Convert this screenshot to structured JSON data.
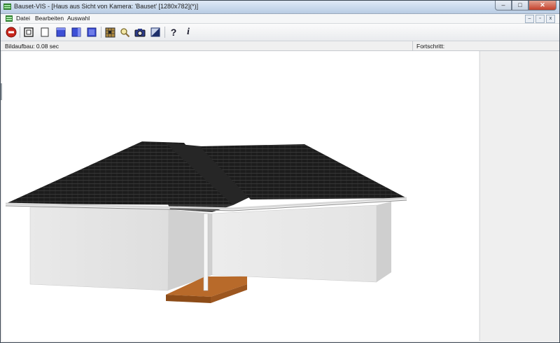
{
  "window": {
    "title": "Bauset-VIS - [Haus aus Sicht von Kamera: 'Bauset' [1280x782](*)]",
    "controls": {
      "minimize": "–",
      "maximize": "□",
      "close": "✕"
    }
  },
  "menubar": {
    "items": [
      {
        "label": "Datei"
      },
      {
        "label": "Bearbeiten"
      },
      {
        "label": "Auswahl"
      }
    ],
    "mdi_controls": {
      "minimize": "–",
      "restore": "▫",
      "close": "x"
    }
  },
  "toolbar": {
    "buttons": [
      {
        "icon": "stop-icon"
      },
      {
        "icon": "frame-view-icon"
      },
      {
        "icon": "blank-page-icon"
      },
      {
        "icon": "cube-view-front-icon"
      },
      {
        "icon": "cube-view-side-icon"
      },
      {
        "icon": "cube-view-top-icon"
      },
      {
        "icon": "texture-icon"
      },
      {
        "icon": "zoom-icon"
      },
      {
        "icon": "camera-icon"
      },
      {
        "icon": "render-icon"
      },
      {
        "icon": "help-icon",
        "glyph": "?"
      },
      {
        "icon": "info-icon",
        "glyph": "i"
      }
    ]
  },
  "status": {
    "render_time": "Bildaufbau: 0.08 sec",
    "progress_label": "Fortschritt:"
  },
  "scene": {
    "roof_color": "#1b1b1b",
    "wall_color": "#e6e6e6",
    "wood_color": "#b86a2a"
  }
}
